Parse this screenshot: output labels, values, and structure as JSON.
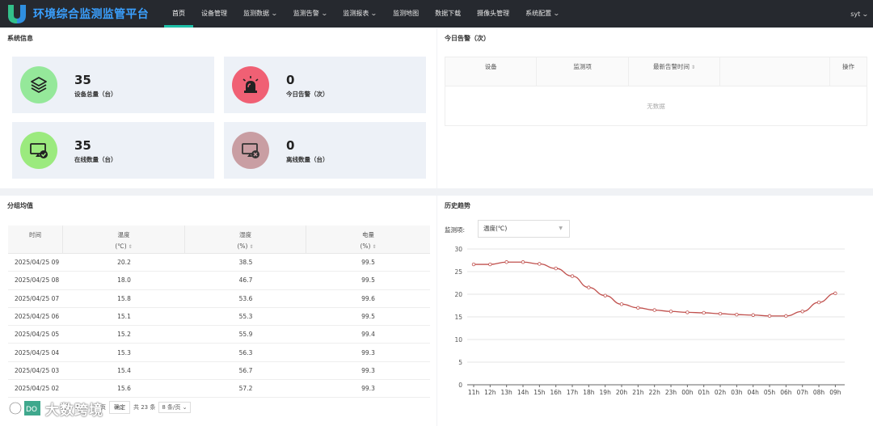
{
  "app": {
    "title": "环境综合监测监管平台",
    "user": "syt"
  },
  "nav": [
    {
      "label": "首页",
      "active": true,
      "dropdown": false
    },
    {
      "label": "设备管理",
      "active": false,
      "dropdown": false
    },
    {
      "label": "监测数据",
      "active": false,
      "dropdown": true
    },
    {
      "label": "监测告警",
      "active": false,
      "dropdown": true
    },
    {
      "label": "监测报表",
      "active": false,
      "dropdown": true
    },
    {
      "label": "监测地图",
      "active": false,
      "dropdown": false
    },
    {
      "label": "数据下载",
      "active": false,
      "dropdown": false
    },
    {
      "label": "摄像头管理",
      "active": false,
      "dropdown": false
    },
    {
      "label": "系统配置",
      "active": false,
      "dropdown": true
    }
  ],
  "system_info": {
    "title": "系统信息",
    "cards": [
      {
        "value": "35",
        "label": "设备总量（台）",
        "icon": "layers-icon",
        "color": "#95e89a"
      },
      {
        "value": "0",
        "label": "今日告警（次）",
        "icon": "alarm-light-icon",
        "color": "#f06074"
      },
      {
        "value": "35",
        "label": "在线数量（台）",
        "icon": "monitor-check-icon",
        "color": "#9bea7e"
      },
      {
        "value": "0",
        "label": "离线数量（台）",
        "icon": "monitor-x-icon",
        "color": "#c99ea3"
      }
    ]
  },
  "alarms": {
    "title": "今日告警（次）",
    "columns": [
      "设备",
      "监测项",
      "最新告警时间",
      "",
      "操作"
    ],
    "empty_text": "无数据"
  },
  "group_avg": {
    "title": "分组均值",
    "columns": [
      {
        "line1": "时间",
        "line2": ""
      },
      {
        "line1": "温度",
        "line2": "(℃)"
      },
      {
        "line1": "湿度",
        "line2": "(%)"
      },
      {
        "line1": "电量",
        "line2": "(%)"
      }
    ],
    "rows": [
      [
        "2025/04/25 09",
        "20.2",
        "38.5",
        "99.5"
      ],
      [
        "2025/04/25 08",
        "18.0",
        "46.7",
        "99.5"
      ],
      [
        "2025/04/25 07",
        "15.8",
        "53.6",
        "99.6"
      ],
      [
        "2025/04/25 06",
        "15.1",
        "55.3",
        "99.5"
      ],
      [
        "2025/04/25 05",
        "15.2",
        "55.9",
        "99.4"
      ],
      [
        "2025/04/25 04",
        "15.3",
        "56.3",
        "99.3"
      ],
      [
        "2025/04/25 03",
        "15.4",
        "56.7",
        "99.3"
      ],
      [
        "2025/04/25 02",
        "15.6",
        "57.2",
        "99.3"
      ]
    ],
    "pager": {
      "page_suffix": "页",
      "confirm": "确定",
      "total": "共 23 条",
      "page_size": "8 条/页"
    }
  },
  "trend": {
    "title": "历史趋势",
    "select_label": "监测项:",
    "select_value": "温度(℃)"
  },
  "watermark": {
    "text": "大数跨境"
  },
  "chart_data": {
    "type": "line",
    "title": "",
    "xlabel": "",
    "ylabel": "",
    "categories": [
      "11h",
      "12h",
      "13h",
      "14h",
      "15h",
      "16h",
      "17h",
      "18h",
      "19h",
      "20h",
      "21h",
      "22h",
      "23h",
      "00h",
      "01h",
      "02h",
      "03h",
      "04h",
      "05h",
      "06h",
      "07h",
      "08h",
      "09h"
    ],
    "series": [
      {
        "color": "#c0504d",
        "values": [
          26.6,
          26.6,
          27.1,
          27.1,
          26.7,
          25.7,
          24.0,
          21.5,
          19.7,
          17.8,
          17.0,
          16.5,
          16.2,
          16.0,
          15.9,
          15.7,
          15.5,
          15.4,
          15.2,
          15.2,
          16.2,
          18.2,
          20.2
        ]
      }
    ],
    "ylim": [
      0,
      30
    ],
    "yticks": [
      0,
      5,
      10,
      15,
      20,
      25,
      30
    ],
    "grid": true
  }
}
